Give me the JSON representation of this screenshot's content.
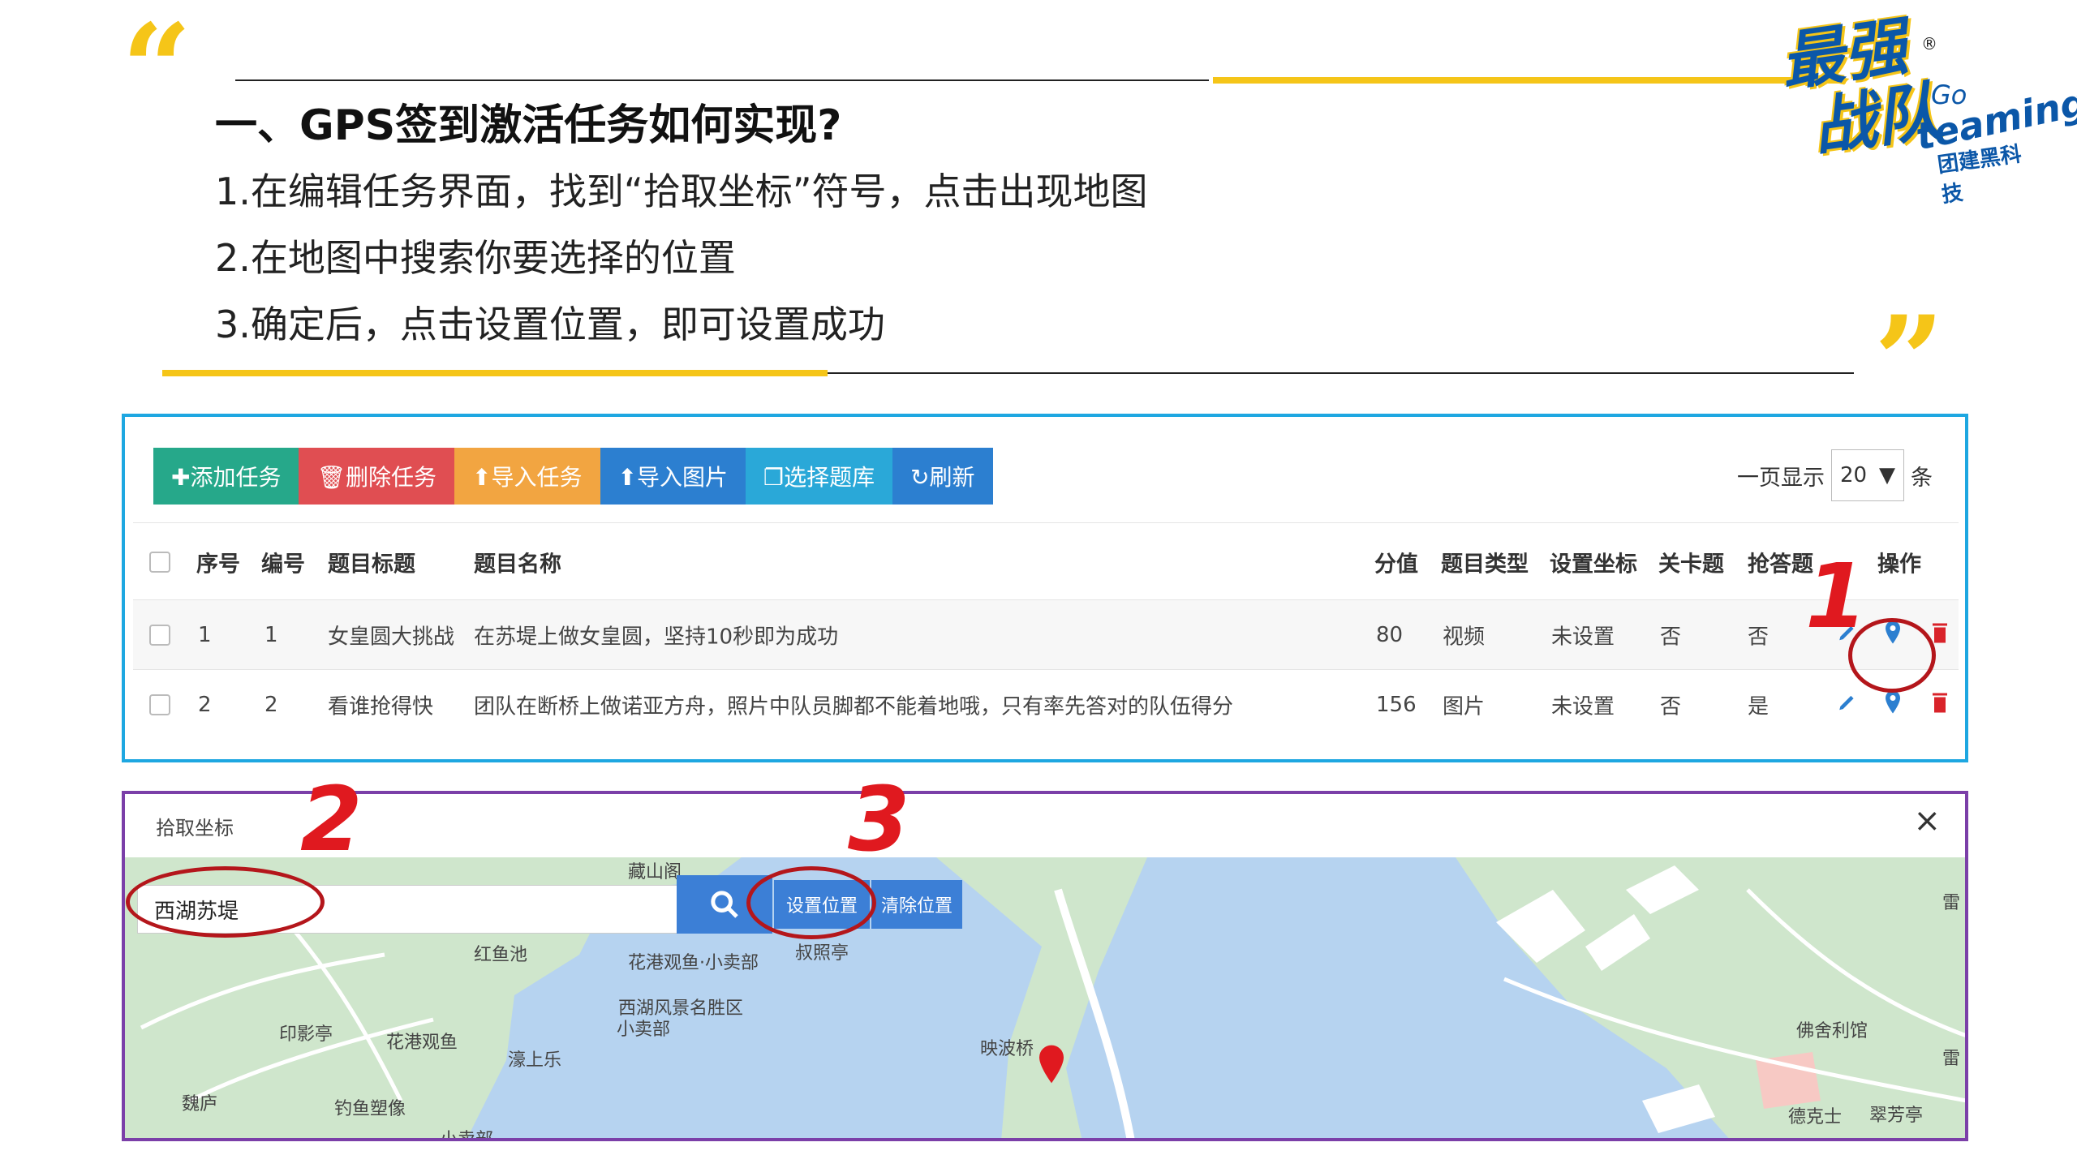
{
  "slide": {
    "heading": "一、GPS签到激活任务如何实现?",
    "steps": [
      "1.在编辑任务界面，找到“拾取坐标”符号，点击出现地图",
      "2.在地图中搜索你要选择的位置",
      "3.确定后，点击设置位置，即可设置成功"
    ],
    "quote_open": "“",
    "quote_close": "”",
    "colors": {
      "accent": "#f5c518",
      "table_border": "#1ea7e1",
      "map_border": "#7b3fa8",
      "annotation": "#e0191f"
    }
  },
  "logo": {
    "line1": "最强",
    "line2": "战队",
    "go": "Go",
    "en": "teaming",
    "sub": "团建黑科技",
    "reg": "®"
  },
  "toolbar": {
    "buttons": [
      {
        "label": "✚添加任务",
        "color": "#26a88a"
      },
      {
        "label": "🗑删除任务",
        "color": "#e04e52"
      },
      {
        "label": "⬆导入任务",
        "color": "#f2a541"
      },
      {
        "label": "⬆导入图片",
        "color": "#2c7fd0"
      },
      {
        "label": "❐选择题库",
        "color": "#2aa8d8"
      },
      {
        "label": "↻刷新",
        "color": "#2c7fd0"
      }
    ],
    "page_size_label": "一页显示",
    "page_size_value": "20",
    "page_size_unit": "条"
  },
  "table": {
    "headers": [
      "序号",
      "编号",
      "题目标题",
      "题目名称",
      "分值",
      "题目类型",
      "设置坐标",
      "关卡题",
      "抢答题",
      "操作"
    ],
    "rows": [
      {
        "seq": "1",
        "id": "1",
        "title": "女皇圆大挑战",
        "name": "在苏堤上做女皇圆，坚持10秒即为成功",
        "score": "80",
        "type": "视频",
        "coord": "未设置",
        "level": "否",
        "rush": "否"
      },
      {
        "seq": "2",
        "id": "2",
        "title": "看谁抢得快",
        "name": "团队在断桥上做诺亚方舟，照片中队员脚都不能着地哦，只有率先答对的队伍得分",
        "score": "156",
        "type": "图片",
        "coord": "未设置",
        "level": "否",
        "rush": "是"
      }
    ]
  },
  "annotations": [
    "1",
    "2",
    "3"
  ],
  "map_dialog": {
    "title": "拾取坐标",
    "close": "×",
    "search_value": "西湖苏堤",
    "set_button": "设置位置",
    "clear_button": "清除位置",
    "pois": [
      "藏山阁",
      "红鱼池",
      "花港观鱼·小卖部",
      "叔照亭",
      "西湖风景名胜区",
      "小卖部",
      "印影亭",
      "花港观鱼",
      "濠上乐",
      "映波桥",
      "钓鱼塑像",
      "魏庐",
      "小卖部",
      "佛舍利馆",
      "德克士",
      "翠芳亭",
      "雷",
      "雷"
    ]
  }
}
